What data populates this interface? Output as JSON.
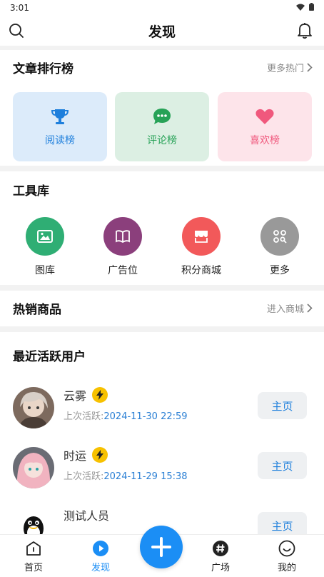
{
  "status": {
    "time": "3:01"
  },
  "header": {
    "title": "发现"
  },
  "ranking": {
    "title": "文章排行榜",
    "more": "更多热门",
    "cards": [
      {
        "label": "阅读榜",
        "icon": "trophy-icon",
        "color": "#1e7fdc",
        "bg": "#dcebfa"
      },
      {
        "label": "评论榜",
        "icon": "comment-icon",
        "color": "#27a257",
        "bg": "#dcefe3"
      },
      {
        "label": "喜欢榜",
        "icon": "heart-icon",
        "color": "#f0587d",
        "bg": "#fde4ea"
      }
    ]
  },
  "tools": {
    "title": "工具库",
    "items": [
      {
        "label": "图库",
        "icon": "image-icon",
        "color": "#2fae74"
      },
      {
        "label": "广告位",
        "icon": "book-icon",
        "color": "#8b3f7c"
      },
      {
        "label": "积分商城",
        "icon": "store-icon",
        "color": "#f2595a"
      },
      {
        "label": "更多",
        "icon": "more-apps-icon",
        "color": "#999999"
      }
    ]
  },
  "hot_goods": {
    "title": "热销商品",
    "more": "进入商城"
  },
  "active_users": {
    "title": "最近活跃用户",
    "last_active_label": "上次活跃:",
    "home_label": "主页",
    "users": [
      {
        "name": "云雾",
        "last_active": "2024-11-30 22:59"
      },
      {
        "name": "时运",
        "last_active": "2024-11-29 15:38"
      },
      {
        "name": "测试人员",
        "last_active": ""
      }
    ]
  },
  "tabbar": {
    "items": [
      {
        "label": "首页"
      },
      {
        "label": "发现"
      },
      {
        "label": "广场"
      },
      {
        "label": "我的"
      }
    ],
    "active_color": "#1b8ef5"
  }
}
